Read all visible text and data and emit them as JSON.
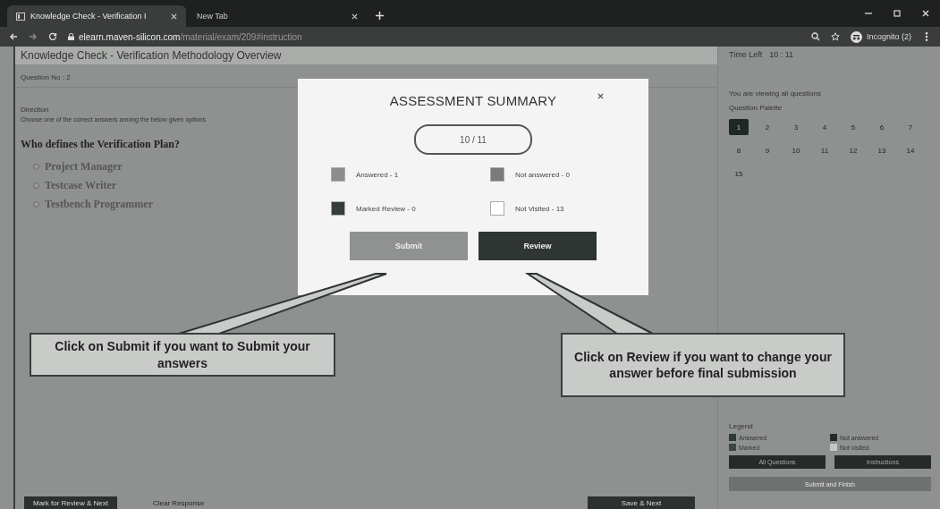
{
  "browser": {
    "tabs": [
      {
        "label": "Knowledge Check - Verification I",
        "selected": true
      },
      {
        "label": "New Tab",
        "selected": false
      }
    ],
    "url_host": "elearn.maven-silicon.com",
    "url_path": "/material/exam/209#instruction",
    "profile": "Incognito (2)"
  },
  "exam": {
    "title": "Knowledge Check - Verification Methodology Overview",
    "question_no": "Question No : 2",
    "direction_label": "Direction",
    "direction_text": "Choose one of the correct answers among the below given options",
    "question": "Who defines the Verification Plan?",
    "options": [
      {
        "label": "Project Manager",
        "selected": false
      },
      {
        "label": "Testcase Writer",
        "selected": false
      },
      {
        "label": "Testbench Programmer",
        "selected": false
      }
    ],
    "buttons": [
      {
        "label": "Mark for Review & Next",
        "kind": "dark"
      },
      {
        "label": "Clear Response",
        "kind": "plain"
      },
      {
        "label": "Save & Next",
        "kind": "dark"
      }
    ]
  },
  "sidebar": {
    "time_label": "Time Left",
    "time": "10 : 11",
    "viewing": "You are viewing all questions",
    "palette_label": "Question Palette",
    "palette": [
      {
        "label": "1",
        "selected": true
      },
      {
        "label": "2",
        "selected": false
      },
      {
        "label": "3",
        "selected": false
      },
      {
        "label": "4",
        "selected": false
      },
      {
        "label": "5",
        "selected": false
      },
      {
        "label": "6",
        "selected": false
      },
      {
        "label": "7",
        "selected": false
      },
      {
        "label": "8",
        "selected": false
      },
      {
        "label": "9",
        "selected": false
      },
      {
        "label": "10",
        "selected": false
      },
      {
        "label": "11",
        "selected": false
      },
      {
        "label": "12",
        "selected": false
      },
      {
        "label": "13",
        "selected": false
      },
      {
        "label": "14",
        "selected": false
      },
      {
        "label": "15",
        "selected": false
      }
    ],
    "legend_label": "Legend",
    "legend": [
      {
        "label": "Answered",
        "color": "#2f3a36"
      },
      {
        "label": "Not answered",
        "color": "#262b29"
      },
      {
        "label": "Marked",
        "color": "#3a4742"
      },
      {
        "label": "Not visited",
        "color": "#c4c7c5"
      }
    ],
    "buttons": [
      {
        "label": "All Questions",
        "kind": "dark"
      },
      {
        "label": "Instructions",
        "kind": "dark"
      },
      {
        "label": "Submit and Finish",
        "kind": "wide"
      }
    ]
  },
  "modal": {
    "title": "ASSESSMENT SUMMARY",
    "score": "10 / 11",
    "stats": [
      {
        "label": "Answered - 1",
        "color": "#8c8c8c"
      },
      {
        "label": "Not answered - 0",
        "color": "#7a7a7a"
      },
      {
        "label": "Marked Review - 0",
        "color": "#353d3a"
      },
      {
        "label": "Not Visited - 13",
        "color": "#ffffff"
      }
    ],
    "submit": "Submit",
    "review": "Review"
  },
  "callouts": [
    {
      "text": "Click on Submit if you want to Submit your answers"
    },
    {
      "text": "Click on Review if you want to change your answer before final submission"
    }
  ]
}
